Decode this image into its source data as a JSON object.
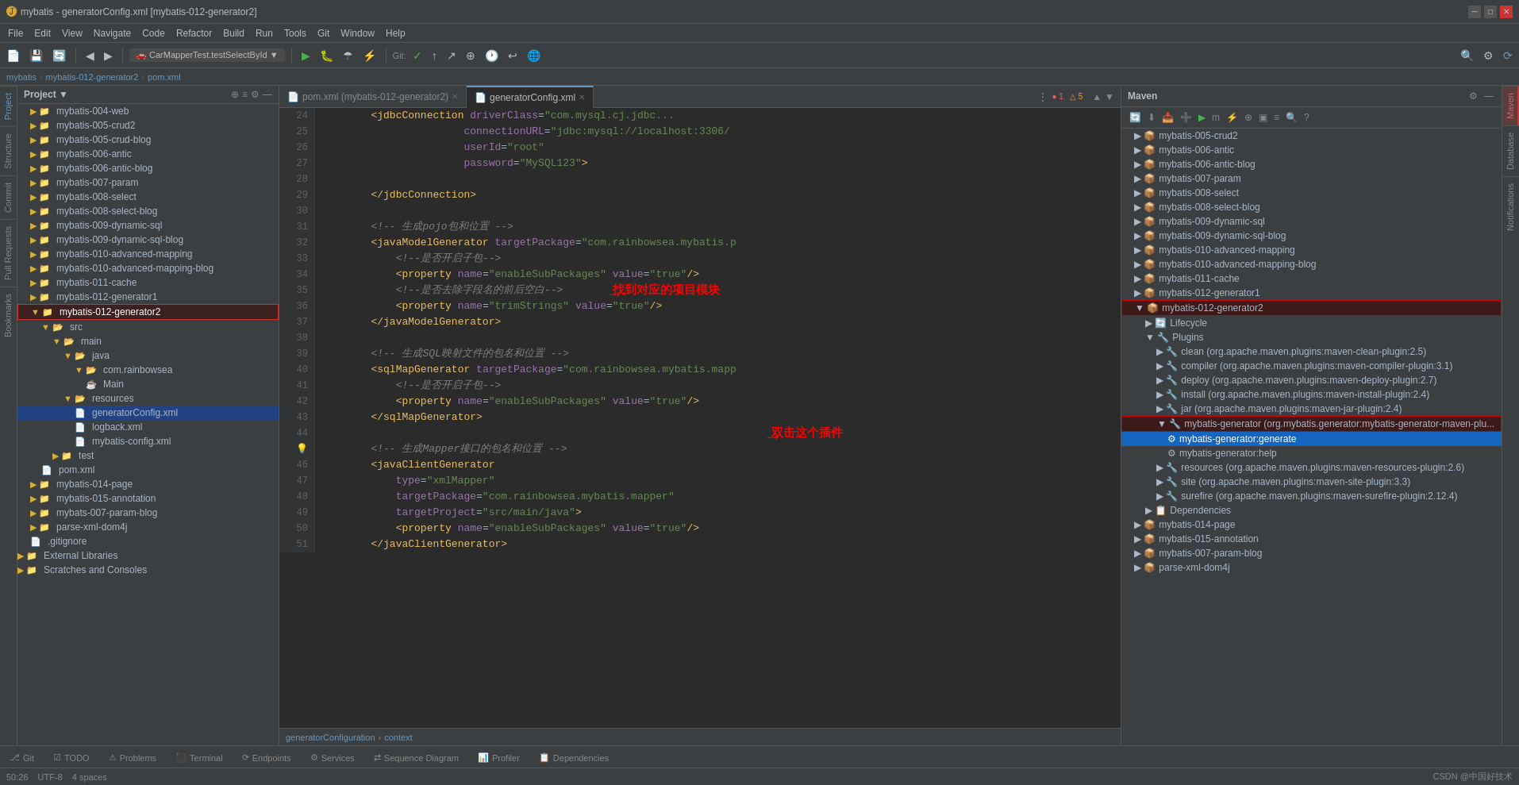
{
  "window": {
    "title": "mybatis - generatorConfig.xml [mybatis-012-generator2]"
  },
  "menubar": {
    "items": [
      "File",
      "Edit",
      "View",
      "Navigate",
      "Code",
      "Refactor",
      "Build",
      "Run",
      "Tools",
      "Git",
      "Window",
      "Help"
    ]
  },
  "breadcrumb": {
    "parts": [
      "mybatis",
      "mybatis-012-generator2",
      "pom.xml"
    ]
  },
  "tabs": [
    {
      "label": "pom.xml (mybatis-012-generator2)",
      "active": false,
      "closable": true
    },
    {
      "label": "generatorConfig.xml",
      "active": true,
      "closable": true
    }
  ],
  "sidebar": {
    "title": "Project",
    "items": [
      {
        "indent": 16,
        "icon": "folder",
        "label": "mybatis-004-web",
        "level": 1
      },
      {
        "indent": 16,
        "icon": "folder",
        "label": "mybatis-005-crud2",
        "level": 1
      },
      {
        "indent": 16,
        "icon": "folder",
        "label": "mybatis-005-crud-blog",
        "level": 1
      },
      {
        "indent": 16,
        "icon": "folder",
        "label": "mybatis-006-antic",
        "level": 1
      },
      {
        "indent": 16,
        "icon": "folder",
        "label": "mybatis-006-antic-blog",
        "level": 1
      },
      {
        "indent": 16,
        "icon": "folder",
        "label": "mybatis-007-param",
        "level": 1
      },
      {
        "indent": 16,
        "icon": "folder",
        "label": "mybatis-008-select",
        "level": 1
      },
      {
        "indent": 16,
        "icon": "folder",
        "label": "mybatis-008-select-blog",
        "level": 1
      },
      {
        "indent": 16,
        "icon": "folder",
        "label": "mybatis-009-dynamic-sql",
        "level": 1
      },
      {
        "indent": 16,
        "icon": "folder",
        "label": "mybatis-009-dynamic-sql-blog",
        "level": 1
      },
      {
        "indent": 16,
        "icon": "folder",
        "label": "mybatis-010-advanced-mapping",
        "level": 1
      },
      {
        "indent": 16,
        "icon": "folder",
        "label": "mybatis-010-advanced-mapping-blog",
        "level": 1
      },
      {
        "indent": 16,
        "icon": "folder",
        "label": "mybatis-011-cache",
        "level": 1
      },
      {
        "indent": 16,
        "icon": "folder",
        "label": "mybatis-012-generator1",
        "level": 1
      },
      {
        "indent": 16,
        "icon": "folder",
        "label": "mybatis-012-generator2",
        "level": 1,
        "highlighted": true
      },
      {
        "indent": 30,
        "icon": "folder-open",
        "label": "src",
        "level": 2
      },
      {
        "indent": 44,
        "icon": "folder-open",
        "label": "main",
        "level": 3
      },
      {
        "indent": 58,
        "icon": "folder-open",
        "label": "java",
        "level": 4
      },
      {
        "indent": 72,
        "icon": "folder-open",
        "label": "com.rainbowsea",
        "level": 5
      },
      {
        "indent": 86,
        "icon": "java",
        "label": "Main",
        "level": 6
      },
      {
        "indent": 58,
        "icon": "folder-open",
        "label": "resources",
        "level": 4
      },
      {
        "indent": 72,
        "icon": "xml",
        "label": "generatorConfig.xml",
        "level": 5
      },
      {
        "indent": 72,
        "icon": "xml",
        "label": "logback.xml",
        "level": 5
      },
      {
        "indent": 72,
        "icon": "xml",
        "label": "mybatis-config.xml",
        "level": 5
      },
      {
        "indent": 44,
        "icon": "folder",
        "label": "test",
        "level": 3
      },
      {
        "indent": 30,
        "icon": "xml",
        "label": "pom.xml",
        "level": 2
      },
      {
        "indent": 16,
        "icon": "folder",
        "label": "mybatis-014-page",
        "level": 1
      },
      {
        "indent": 16,
        "icon": "folder",
        "label": "mybatis-015-annotation",
        "level": 1
      },
      {
        "indent": 16,
        "icon": "folder",
        "label": "mybats-007-param-blog",
        "level": 1
      },
      {
        "indent": 16,
        "icon": "folder",
        "label": "parse-xml-dom4j",
        "level": 1
      },
      {
        "indent": 16,
        "icon": "file",
        "label": ".gitignore",
        "level": 1
      },
      {
        "indent": 0,
        "icon": "folder",
        "label": "External Libraries",
        "level": 0
      },
      {
        "indent": 0,
        "icon": "folder",
        "label": "Scratches and Consoles",
        "level": 0
      }
    ]
  },
  "code": {
    "lines": [
      {
        "num": 24,
        "content": "        <jdbcConnection driverClass=\"com.mysql.cj.jdbc...",
        "type": "xml"
      },
      {
        "num": 25,
        "content": "                       connectionURL=\"jdbc:mysql://localhost:3306/",
        "type": "xml"
      },
      {
        "num": 26,
        "content": "                       userId=\"root\"",
        "type": "xml"
      },
      {
        "num": 27,
        "content": "                       password=\"MySQL123\">",
        "type": "xml"
      },
      {
        "num": 28,
        "content": "",
        "type": "empty"
      },
      {
        "num": 29,
        "content": "        </jdbcConnection>",
        "type": "xml"
      },
      {
        "num": 30,
        "content": "",
        "type": "empty"
      },
      {
        "num": 31,
        "content": "        <!-- 生成pojo包和位置 -->",
        "type": "comment"
      },
      {
        "num": 32,
        "content": "        <javaModelGenerator targetPackage=\"com.rainbowsea.mybatis.p",
        "type": "xml"
      },
      {
        "num": 33,
        "content": "            <!--是否开启子包-->",
        "type": "comment"
      },
      {
        "num": 34,
        "content": "            <property name=\"enableSubPackages\" value=\"true\"/>",
        "type": "xml"
      },
      {
        "num": 35,
        "content": "            <!--是否去除字段名的前后空白-->",
        "type": "comment"
      },
      {
        "num": 36,
        "content": "            <property name=\"trimStrings\" value=\"true\"/>",
        "type": "xml"
      },
      {
        "num": 37,
        "content": "        </javaModelGenerator>",
        "type": "xml"
      },
      {
        "num": 38,
        "content": "",
        "type": "empty"
      },
      {
        "num": 39,
        "content": "        <!-- 生成SQL映射文件的包名和位置 -->",
        "type": "comment"
      },
      {
        "num": 40,
        "content": "        <sqlMapGenerator targetPackage=\"com.rainbowsea.mybatis.mapp",
        "type": "xml"
      },
      {
        "num": 41,
        "content": "            <!--是否开启子包-->",
        "type": "comment"
      },
      {
        "num": 42,
        "content": "            <property name=\"enableSubPackages\" value=\"true\"/>",
        "type": "xml"
      },
      {
        "num": 43,
        "content": "        </sqlMapGenerator>",
        "type": "xml"
      },
      {
        "num": 44,
        "content": "",
        "type": "empty"
      },
      {
        "num": 45,
        "content": "        <!-- 生成Mapper接口的包名和位置 -->",
        "type": "comment"
      },
      {
        "num": 46,
        "content": "        <javaClientGenerator",
        "type": "xml"
      },
      {
        "num": 47,
        "content": "            type=\"xmlMapper\"",
        "type": "xml"
      },
      {
        "num": 48,
        "content": "            targetPackage=\"com.rainbowsea.mybatis.mapper\"",
        "type": "xml"
      },
      {
        "num": 49,
        "content": "            targetProject=\"src/main/java\">",
        "type": "xml"
      },
      {
        "num": 50,
        "content": "            <property name=\"enableSubPackages\" value=\"true\"/>",
        "type": "xml"
      },
      {
        "num": 51,
        "content": "        </javaClientGenerator>",
        "type": "xml"
      }
    ],
    "breadcrumb": "generatorConfiguration > context"
  },
  "maven": {
    "title": "Maven",
    "projects": [
      {
        "label": "mybatis-005-crud2",
        "indent": 16,
        "type": "module"
      },
      {
        "label": "mybatis-006-antic",
        "indent": 16,
        "type": "module"
      },
      {
        "label": "mybatis-006-antic-blog",
        "indent": 16,
        "type": "module"
      },
      {
        "label": "mybatis-007-param",
        "indent": 16,
        "type": "module"
      },
      {
        "label": "mybatis-008-select",
        "indent": 16,
        "type": "module"
      },
      {
        "label": "mybatis-008-select-blog",
        "indent": 16,
        "type": "module"
      },
      {
        "label": "mybatis-009-dynamic-sql",
        "indent": 16,
        "type": "module"
      },
      {
        "label": "mybatis-009-dynamic-sql-blog",
        "indent": 16,
        "type": "module"
      },
      {
        "label": "mybatis-010-advanced-mapping",
        "indent": 16,
        "type": "module"
      },
      {
        "label": "mybatis-010-advanced-mapping-blog",
        "indent": 16,
        "type": "module"
      },
      {
        "label": "mybatis-011-cache",
        "indent": 16,
        "type": "module"
      },
      {
        "label": "mybatis-012-generator1",
        "indent": 16,
        "type": "module"
      },
      {
        "label": "mybatis-012-generator2",
        "indent": 16,
        "type": "module",
        "highlighted": true
      },
      {
        "label": "Lifecycle",
        "indent": 30,
        "type": "group"
      },
      {
        "label": "Plugins",
        "indent": 30,
        "type": "group",
        "expanded": true
      },
      {
        "label": "clean (org.apache.maven.plugins:maven-clean-plugin:2.5)",
        "indent": 44,
        "type": "plugin"
      },
      {
        "label": "compiler (org.apache.maven.plugins:maven-compiler-plugin:3.1)",
        "indent": 44,
        "type": "plugin"
      },
      {
        "label": "deploy (org.apache.maven.plugins:maven-deploy-plugin:2.7)",
        "indent": 44,
        "type": "plugin"
      },
      {
        "label": "install (org.apache.maven.plugins:maven-install-plugin:2.4)",
        "indent": 44,
        "type": "plugin"
      },
      {
        "label": "jar (org.apache.maven.plugins:maven-jar-plugin:2.4)",
        "indent": 44,
        "type": "plugin"
      },
      {
        "label": "mybatis-generator (org.mybatis.generator:mybatis-generator-maven-plu...",
        "indent": 44,
        "type": "plugin",
        "special": true
      },
      {
        "label": "mybatis-generator:generate",
        "indent": 58,
        "type": "goal",
        "active": true
      },
      {
        "label": "mybatis-generator:help",
        "indent": 58,
        "type": "goal"
      },
      {
        "label": "resources (org.apache.maven.plugins:maven-resources-plugin:2.6)",
        "indent": 44,
        "type": "plugin"
      },
      {
        "label": "site (org.apache.maven.plugins:maven-site-plugin:3.3)",
        "indent": 44,
        "type": "plugin"
      },
      {
        "label": "surefire (org.apache.maven.plugins:maven-surefire-plugin:2.12.4)",
        "indent": 44,
        "type": "plugin"
      },
      {
        "label": "Dependencies",
        "indent": 30,
        "type": "group"
      },
      {
        "label": "mybatis-014-page",
        "indent": 16,
        "type": "module"
      },
      {
        "label": "mybatis-015-annotation",
        "indent": 16,
        "type": "module"
      },
      {
        "label": "mybatis-007-param-blog",
        "indent": 16,
        "type": "module"
      },
      {
        "label": "parse-xml-dom4j",
        "indent": 16,
        "type": "module"
      }
    ]
  },
  "bottombar": {
    "tabs": [
      {
        "label": "Git",
        "icon": "git"
      },
      {
        "label": "TODO",
        "icon": "todo"
      },
      {
        "label": "Problems",
        "icon": "problems"
      },
      {
        "label": "Terminal",
        "icon": "terminal"
      },
      {
        "label": "Endpoints",
        "icon": "endpoints"
      },
      {
        "label": "Services",
        "icon": "services"
      },
      {
        "label": "Sequence Diagram",
        "icon": "sequence"
      },
      {
        "label": "Profiler",
        "icon": "profiler"
      },
      {
        "label": "Dependencies",
        "icon": "dependencies"
      }
    ]
  },
  "statusbar": {
    "right_text": "CSDN @中国好技术",
    "line_col": "50:26"
  },
  "annotations": {
    "find_module": "找到对应的项目模块",
    "double_click": "双击这个插件"
  }
}
